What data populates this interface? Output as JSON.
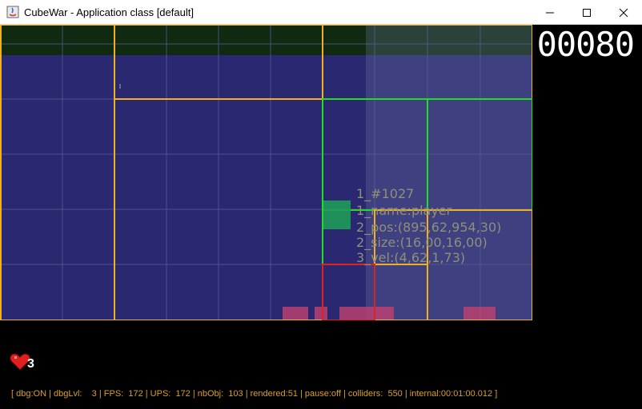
{
  "window": {
    "title": "CubeWar - Application class [default]",
    "minimize_icon": "minimize-icon",
    "maximize_icon": "maximize-icon",
    "close_icon": "close-icon"
  },
  "hud": {
    "score": "00080",
    "lives": "3",
    "lives_icon": "heart-icon"
  },
  "debug_info": {
    "lines": [
      "1_#1027",
      "1_name:player",
      "2_pos:(895,62,954,30)",
      "2_size:(16,00,16,00)",
      "3_vel:(4,62,1,73)"
    ]
  },
  "status_bar": "[ dbg:ON | dbgLvl:    3 | FPS:  172 | UPS:  172 | nbObj:  103 | rendered:51 | pause:off | colliders:  550 | internal:00:01:00.012 ]",
  "colors": {
    "zone_green": "#0f2a10",
    "zone_blue": "#2a2870",
    "quadtree_orange": "#f0b020",
    "quadtree_green": "#22dd22",
    "quadtree_red": "#dd2222",
    "player": "#1e9a5a",
    "status_text": "#d9a020"
  }
}
